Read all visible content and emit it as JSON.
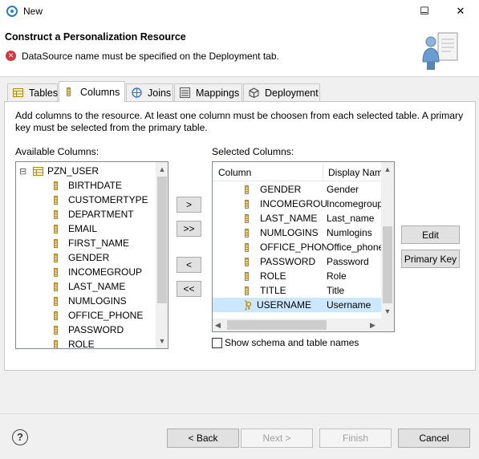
{
  "window": {
    "title": "New",
    "controls": {
      "minimize": "–",
      "maximize": "☐",
      "close": "✕"
    }
  },
  "header": {
    "title": "Construct a Personalization Resource",
    "error_message": "DataSource name must be specified on the Deployment tab.",
    "error_glyph": "✕"
  },
  "tabs": [
    {
      "label": "Tables",
      "icon": "table-icon",
      "active": false
    },
    {
      "label": "Columns",
      "icon": "column-icon",
      "active": true
    },
    {
      "label": "Joins",
      "icon": "joins-icon",
      "active": false
    },
    {
      "label": "Mappings",
      "icon": "mappings-icon",
      "active": false
    },
    {
      "label": "Deployment",
      "icon": "deployment-icon",
      "active": false
    }
  ],
  "description": "Add columns to the resource.  At least one column must be choosen from each selected table.  A primary key must be selected from the primary table.",
  "available": {
    "label": "Available Columns:",
    "table_name": "PZN_USER",
    "expand_glyph": "⊟",
    "columns": [
      "BIRTHDATE",
      "CUSTOMERTYPE",
      "DEPARTMENT",
      "EMAIL",
      "FIRST_NAME",
      "GENDER",
      "INCOMEGROUP",
      "LAST_NAME",
      "NUMLOGINS",
      "OFFICE_PHONE",
      "PASSWORD",
      "ROLE"
    ]
  },
  "move_buttons": {
    "add": ">",
    "add_all": ">>",
    "remove": "<",
    "remove_all": "<<"
  },
  "selected": {
    "label": "Selected Columns:",
    "headers": {
      "column": "Column",
      "display_name": "Display Name"
    },
    "rows": [
      {
        "column": "GENDER",
        "display": "Gender",
        "selected": false
      },
      {
        "column": "INCOMEGROUP",
        "display": "Incomegroup",
        "selected": false
      },
      {
        "column": "LAST_NAME",
        "display": "Last_name",
        "selected": false
      },
      {
        "column": "NUMLOGINS",
        "display": "Numlogins",
        "selected": false
      },
      {
        "column": "OFFICE_PHONE",
        "display": "Office_phone",
        "selected": false
      },
      {
        "column": "PASSWORD",
        "display": "Password",
        "selected": false
      },
      {
        "column": "ROLE",
        "display": "Role",
        "selected": false
      },
      {
        "column": "TITLE",
        "display": "Title",
        "selected": false
      },
      {
        "column": "USERNAME",
        "display": "Username",
        "selected": true,
        "primary_key": true
      }
    ]
  },
  "side_buttons": {
    "edit": "Edit",
    "primary_key": "Primary Key"
  },
  "show_schema": {
    "label": "Show schema and table names",
    "checked": false
  },
  "footer": {
    "help": "?",
    "back": "< Back",
    "next": "Next >",
    "finish": "Finish",
    "cancel": "Cancel"
  },
  "scroll": {
    "up": "▲",
    "down": "▼",
    "left": "◀",
    "right": "▶"
  }
}
